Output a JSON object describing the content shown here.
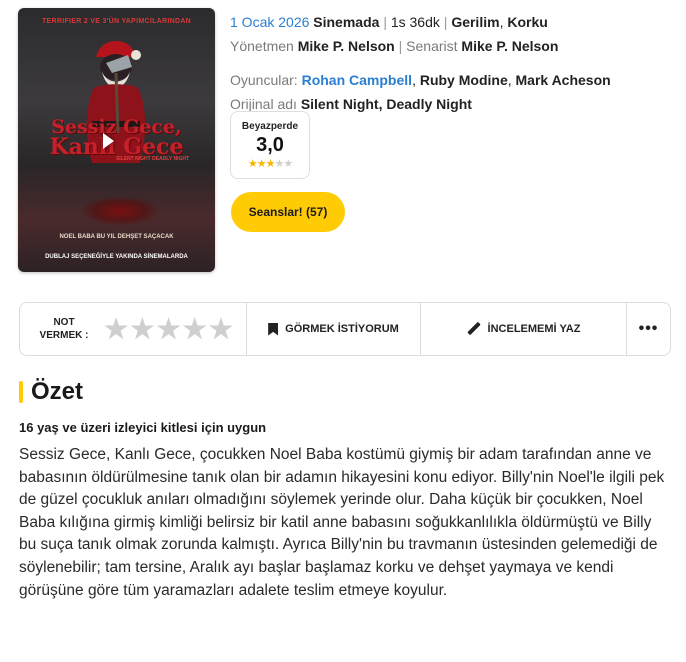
{
  "poster": {
    "top_text": "TERRIFIER 2 VE 3'ÜN YAPIMCILARINDAN",
    "title_line1": "Sessiz Gece,",
    "title_line2": "Kanlı Gece",
    "original_small": "SILENT NIGHT DEADLY NIGHT",
    "tagline": "NOEL BABA BU YIL DEHŞET SAÇACAK",
    "bottom_text": "DUBLAJ SEÇENEĞİYLE YAKINDA SİNEMALARDA"
  },
  "info": {
    "date": "1 Ocak 2026",
    "status": "Sinemada",
    "separator": "|",
    "duration": "1s 36dk",
    "genres": [
      "Gerilim",
      "Korku"
    ],
    "director_label": "Yönetmen",
    "director": "Mike P. Nelson",
    "writer_label": "Senarist",
    "writer": "Mike P. Nelson",
    "cast_label": "Oyuncular:",
    "cast": [
      "Rohan Campbell",
      "Ruby Modine",
      "Mark Acheson"
    ],
    "original_title_label": "Orijinal adı",
    "original_title": "Silent Night, Deadly Night"
  },
  "score": {
    "label": "Beyazperde",
    "value": "3,0",
    "stars_fraction": 0.6,
    "star_color": "#f4b700"
  },
  "sessions_button": "Seanslar! (57)",
  "actions": {
    "rate_label": "NOT VERMEK :",
    "watch_label": "GÖRMEK İSTİYORUM",
    "review_label": "İNCELEMEMİ YAZ",
    "more_label": "•••"
  },
  "summary": {
    "title": "Özet",
    "age_rating": "16 yaş ve üzeri izleyici kitlesi için uygun",
    "text": "Sessiz Gece, Kanlı Gece, çocukken Noel Baba kostümü giymiş bir adam tarafından anne ve babasının öldürülmesine tanık olan bir adamın hikayesini konu ediyor. Billy'nin Noel'le ilgili pek de güzel çocukluk anıları olmadığını söylemek yerinde olur. Daha küçük bir çocukken, Noel Baba kılığına girmiş kimliği belirsiz bir katil anne babasını soğukkanlılıkla öldürmüştü ve Billy bu suça tanık olmak zorunda kalmıştı. Ayrıca Billy'nin bu travmanın üstesinden gelemediği de söylenebilir; tam tersine, Aralık ayı başlar başlamaz korku ve dehşet yaymaya ve kendi görüşüne göre tüm yaramazları adalete teslim etmeye koyulur."
  },
  "colors": {
    "accent": "#ffcb05",
    "link": "#2a7fd0"
  }
}
